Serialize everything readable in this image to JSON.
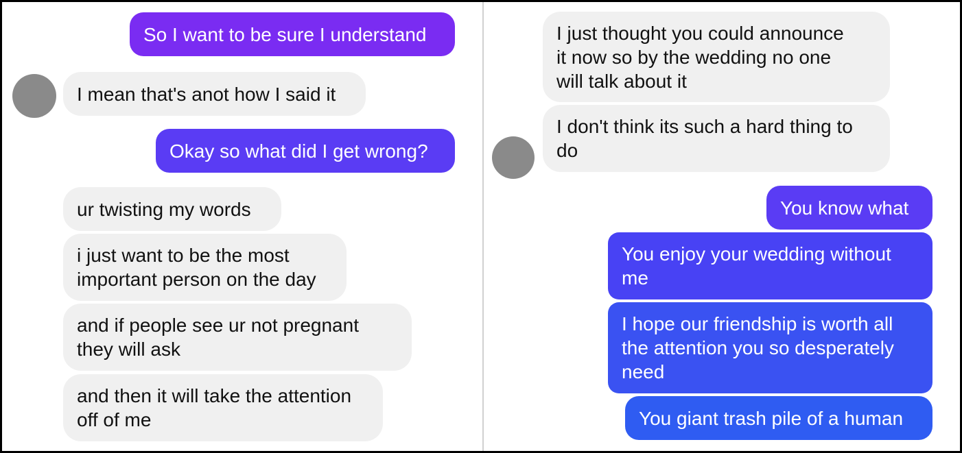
{
  "colors": {
    "received_bg": "#f0f0f0",
    "received_text": "#111111",
    "sent_text": "#ffffff",
    "sent_purple": "#7a2cf2",
    "sent_indigo": "#5a3cf4",
    "sent_blue": "#2f5cf2",
    "avatar": "#8a8a8a"
  },
  "left_panel": {
    "messages": [
      {
        "from": "me",
        "lines": [
          "So I want to be sure I understand"
        ]
      },
      {
        "from": "them",
        "lines": [
          "I mean that's anot how I said it"
        ]
      },
      {
        "from": "me",
        "lines": [
          "Okay so what did I get wrong?"
        ]
      },
      {
        "from": "them",
        "lines": [
          "ur twisting my words"
        ]
      },
      {
        "from": "them",
        "lines": [
          "i just want to be the most",
          "important person on the day"
        ]
      },
      {
        "from": "them",
        "lines": [
          "and if people see ur not pregnant",
          "they will ask"
        ]
      },
      {
        "from": "them",
        "lines": [
          "and then it will take the attention",
          "off of me"
        ]
      }
    ]
  },
  "right_panel": {
    "messages": [
      {
        "from": "them",
        "lines": [
          "I just thought you could announce",
          "it now so by the wedding no one",
          "will talk about it"
        ]
      },
      {
        "from": "them",
        "lines": [
          "I don't think its such a hard thing to",
          "do"
        ]
      },
      {
        "from": "me",
        "lines": [
          "You know what"
        ]
      },
      {
        "from": "me",
        "lines": [
          "You enjoy your wedding without",
          "me"
        ]
      },
      {
        "from": "me",
        "lines": [
          "I hope our friendship is worth all",
          "the attention you so desperately",
          "need"
        ]
      },
      {
        "from": "me",
        "lines": [
          "You giant trash pile of a human"
        ]
      }
    ]
  }
}
